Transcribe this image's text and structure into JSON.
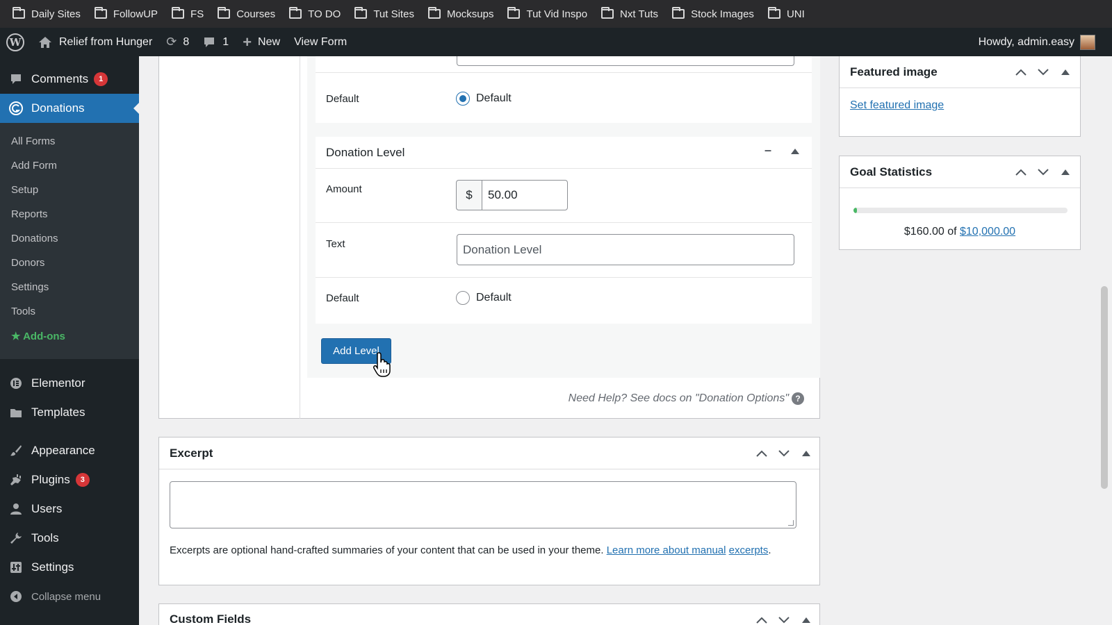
{
  "bookmarks": [
    "Daily Sites",
    "FollowUP",
    "FS",
    "Courses",
    "TO DO",
    "Tut Sites",
    "Mocksups",
    "Tut Vid Inspo",
    "Nxt Tuts",
    "Stock Images",
    "UNI"
  ],
  "adminbar": {
    "site_name": "Relief from Hunger",
    "updates_count": "8",
    "comments_count": "1",
    "new_label": "New",
    "view_form": "View Form",
    "howdy": "Howdy, admin.easy"
  },
  "sidebar": {
    "comments": {
      "label": "Comments",
      "badge": "1"
    },
    "donations": "Donations",
    "submenu": [
      "All Forms",
      "Add Form",
      "Setup",
      "Reports",
      "Donations",
      "Donors",
      "Settings",
      "Tools"
    ],
    "addons": "Add-ons",
    "elementor": "Elementor",
    "templates": "Templates",
    "appearance": "Appearance",
    "plugins": {
      "label": "Plugins",
      "badge": "3"
    },
    "users": "Users",
    "tools": "Tools",
    "settings": "Settings",
    "collapse": "Collapse menu"
  },
  "form": {
    "prev_default_label": "Default",
    "prev_default_option": "Default",
    "level_title": "Donation Level",
    "collapse_glyph": "–",
    "amount_label": "Amount",
    "currency": "$",
    "amount_value": "50.00",
    "text_label": "Text",
    "text_placeholder": "Donation Level",
    "default_label": "Default",
    "default_option": "Default",
    "add_level": "Add Level",
    "help_text": "Need Help? See docs on \"Donation Options\""
  },
  "featured_image": {
    "title": "Featured image",
    "link": "Set featured image"
  },
  "goal_statistics": {
    "title": "Goal Statistics",
    "raised": "$160.00",
    "of": "of",
    "goal": "$10,000.00",
    "progress_fraction": 0.016
  },
  "excerpt": {
    "title": "Excerpt",
    "help": "Excerpts are optional hand-crafted summaries of your content that can be used in your theme.",
    "link_1": "Learn more about manual",
    "link_2": "excerpts",
    "period": "."
  },
  "custom_fields": {
    "title": "Custom Fields"
  }
}
